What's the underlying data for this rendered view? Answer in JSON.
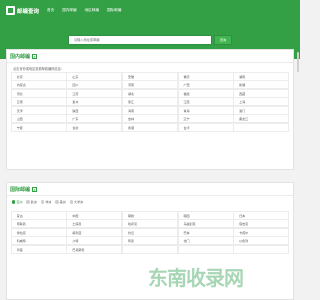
{
  "header": {
    "logo_text": "邮编查询",
    "nav": [
      "首页",
      "国内邮编",
      "地区邮编",
      "国际邮编"
    ]
  },
  "search": {
    "placeholder": "请输入地址或邮编",
    "button_label": "查询"
  },
  "domestic": {
    "title": "国内邮编",
    "badge": "#",
    "intro": "点击省份或地区查看邮政编码信息：",
    "cells": [
      "北京",
      "山东",
      "安徽",
      "重庆",
      "湖南",
      "内蒙古",
      "四川",
      "河南",
      "广西",
      "新疆",
      "河北",
      "江苏",
      "湖北",
      "福建",
      "西藏",
      "云南",
      "贵州",
      "浙江",
      "江西",
      "上海",
      "天津",
      "陕西",
      "海南",
      "青海",
      "澳门",
      "山西",
      "广东",
      "吉林",
      "辽宁",
      "黑龙江",
      "宁夏",
      "甘肃",
      "香港",
      "台湾",
      ""
    ]
  },
  "international": {
    "title": "国际邮编",
    "badge": "#",
    "tabs": [
      {
        "label": "亚洲",
        "active": true
      },
      {
        "label": "欧洲",
        "active": false
      },
      {
        "label": "非洲",
        "active": false
      },
      {
        "label": "美洲",
        "active": false
      },
      {
        "label": "大洋洲",
        "active": false
      }
    ],
    "cells": [
      "蒙古",
      "中国",
      "朝鲜",
      "韩国",
      "日本",
      "阿联酋",
      "土库曼",
      "哈萨克",
      "乌兹别克",
      "塔吉克",
      "伊拉克",
      "叙利亚",
      "约旦",
      "巴林",
      "卡塔尔",
      "科威特",
      "沙特",
      "阿曼",
      "也门",
      "以色列",
      "印度",
      "巴基斯坦",
      "",
      "",
      ""
    ]
  },
  "watermark": "东南收录网"
}
